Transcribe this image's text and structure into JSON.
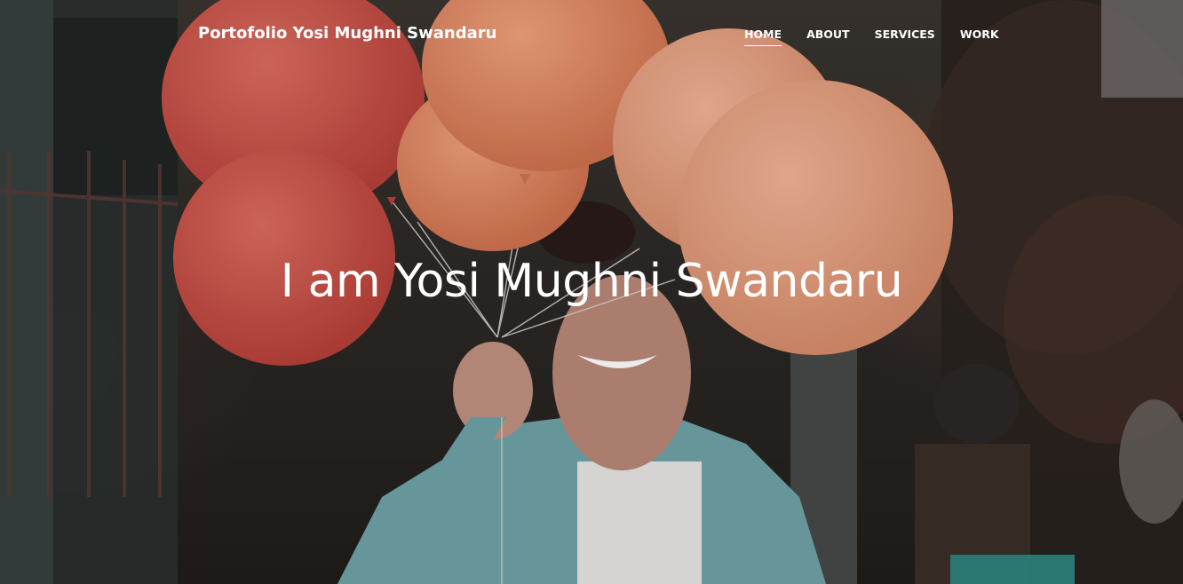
{
  "site": {
    "brand": "Portofolio Yosi Mughni Swandaru",
    "headline": "I am Yosi Mughni Swandaru"
  },
  "nav": {
    "items": [
      {
        "label": "HOME",
        "active": true
      },
      {
        "label": "ABOUT",
        "active": false
      },
      {
        "label": "SERVICES",
        "active": false
      },
      {
        "label": "WORK",
        "active": false
      }
    ]
  },
  "colors": {
    "nav_text": "#ffffff",
    "headline_text": "#ffffff",
    "balloon_red": "#c9534a",
    "balloon_orange": "#e28a68",
    "balloon_peach": "#e9a183",
    "jacket_teal": "#6fa3a6"
  }
}
